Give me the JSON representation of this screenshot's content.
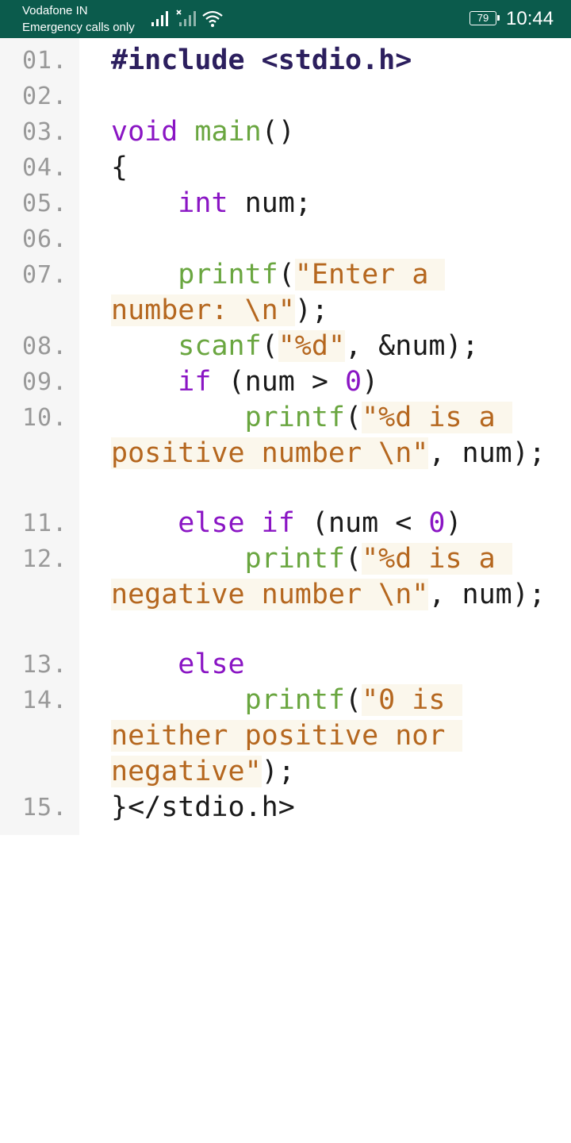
{
  "status_bar": {
    "carrier": "Vodafone IN",
    "emergency": "Emergency calls only",
    "battery": "79",
    "time": "10:44",
    "icons": [
      "signal-icon",
      "signal-no-service-icon",
      "wifi-icon",
      "battery-icon"
    ],
    "bg_color": "#0b5b4c"
  },
  "code": {
    "line_numbers": [
      "01.",
      "02.",
      "03.",
      "04.",
      "05.",
      "06.",
      "07.",
      "08.",
      "09.",
      "10.",
      "11.",
      "12.",
      "13.",
      "14.",
      "15."
    ],
    "l1": {
      "pre": "#include <stdio.h>"
    },
    "l3": {
      "kw": "void",
      "sp": " ",
      "fn": "main",
      "rest": "()"
    },
    "l4": {
      "text": "{"
    },
    "l5": {
      "indent": "    ",
      "kw": "int",
      "rest": " num;"
    },
    "l7": {
      "indent": "    ",
      "fn": "printf",
      "p1": "(",
      "s1": "\"Enter a ",
      "s2": "number: \\n\"",
      "rest": ");"
    },
    "l8": {
      "indent": "    ",
      "fn": "scanf",
      "p1": "(",
      "s1": "\"%d\"",
      "rest": ", &num);"
    },
    "l9": {
      "indent": "    ",
      "kw": "if",
      "p1": " (num > ",
      "num": "0",
      "rest": ")"
    },
    "l10": {
      "indent": "        ",
      "fn": "printf",
      "p1": "(",
      "s1": "\"%d is a ",
      "s2": "positive number \\n\"",
      "rest": ", num);"
    },
    "l11": {
      "indent": "    ",
      "kw": "else if",
      "p1": " (num < ",
      "num": "0",
      "rest": ")"
    },
    "l12": {
      "indent": "        ",
      "fn": "printf",
      "p1": "(",
      "s1": "\"%d is a ",
      "s2": "negative number \\n\"",
      "rest": ", num);"
    },
    "l13": {
      "indent": "    ",
      "kw": "else"
    },
    "l14": {
      "indent": "        ",
      "fn": "printf",
      "p1": "(",
      "s1": "\"0 is ",
      "s2": "neither positive nor ",
      "s3": "negative\"",
      "rest": ");"
    },
    "l15": {
      "text": "}</stdio.h>"
    },
    "colors": {
      "preprocessor": "#2c1f5e",
      "keyword": "#8a15c4",
      "function": "#6aa640",
      "string": "#b5671f",
      "number": "#8a15c4",
      "line_number": "#999999",
      "gutter_bg": "#f6f6f6"
    }
  }
}
